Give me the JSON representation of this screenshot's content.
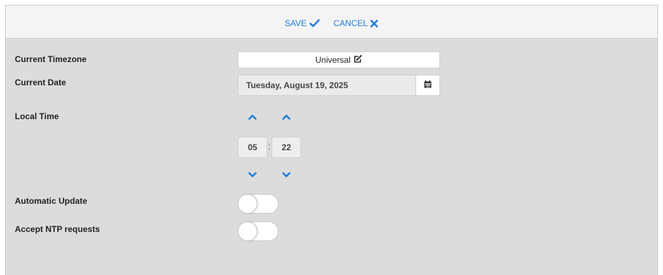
{
  "toolbar": {
    "save_label": "SAVE",
    "cancel_label": "CANCEL",
    "accent_color": "#1f7ee0"
  },
  "settings": {
    "timezone_label": "Current Timezone",
    "timezone_value": "Universal",
    "date_label": "Current Date",
    "date_value": "Tuesday, August 19, 2025",
    "local_time_label": "Local Time",
    "hours": "05",
    "separator": ":",
    "minutes": "22",
    "auto_update_label": "Automatic Update",
    "auto_update_enabled": false,
    "ntp_label": "Accept NTP requests",
    "ntp_enabled": false
  },
  "icons": {
    "save": "checkmark-icon",
    "cancel": "x-mark-icon",
    "timezone_edit": "edit-icon",
    "date_picker": "calendar-icon",
    "increment": "chevron-up-icon",
    "decrement": "chevron-down-icon"
  }
}
